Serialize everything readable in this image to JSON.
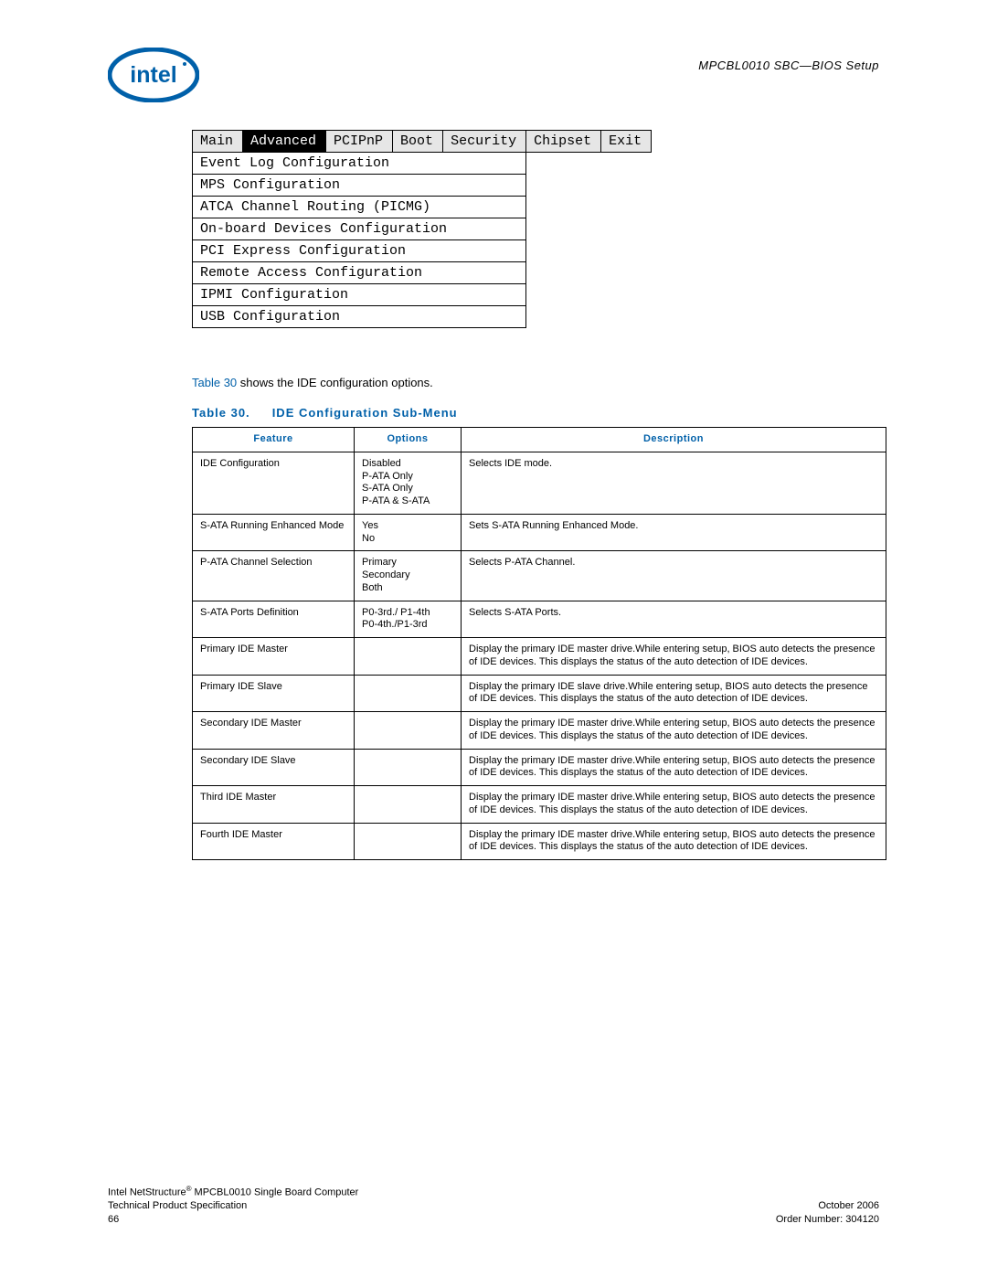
{
  "header": {
    "doc_title": "MPCBL0010 SBC—BIOS Setup"
  },
  "bios_menu": {
    "tabs": [
      "Main",
      "Advanced",
      "PCIPnP",
      "Boot",
      "Security",
      "Chipset",
      "Exit"
    ],
    "active_tab_index": 1,
    "items": [
      "Event Log Configuration",
      "MPS Configuration",
      "ATCA Channel Routing (PICMG)",
      "On-board Devices Configuration",
      "PCI Express Configuration",
      "Remote Access Configuration",
      "IPMI Configuration",
      "USB Configuration"
    ]
  },
  "intro": {
    "link": "Table 30",
    "rest": " shows the IDE configuration options."
  },
  "table_caption": {
    "number": "Table 30.",
    "title": "IDE Configuration Sub-Menu"
  },
  "table_headers": [
    "Feature",
    "Options",
    "Description"
  ],
  "config_rows": [
    {
      "feature": "IDE Configuration",
      "options": "Disabled\nP-ATA Only\nS-ATA Only\nP-ATA & S-ATA",
      "description": "Selects IDE mode."
    },
    {
      "feature": "S-ATA Running Enhanced Mode",
      "options": "Yes\nNo",
      "description": "Sets S-ATA Running Enhanced Mode."
    },
    {
      "feature": "P-ATA Channel Selection",
      "options": "Primary\nSecondary\nBoth",
      "description": "Selects P-ATA Channel."
    },
    {
      "feature": "S-ATA Ports Definition",
      "options": "P0-3rd./ P1-4th\nP0-4th./P1-3rd",
      "description": "Selects S-ATA Ports."
    },
    {
      "feature": "Primary IDE Master",
      "options": "",
      "description": "Display the primary IDE master drive.While entering setup, BIOS auto detects the presence of IDE devices. This displays the status of the auto detection of IDE devices."
    },
    {
      "feature": "Primary IDE Slave",
      "options": "",
      "description": "Display the primary IDE slave drive.While entering setup, BIOS auto detects the presence of IDE devices. This displays the status of the auto detection of IDE devices."
    },
    {
      "feature": "Secondary IDE Master",
      "options": "",
      "description": "Display the primary IDE master drive.While entering setup, BIOS auto detects the presence of IDE devices. This displays the status of the auto detection of IDE devices."
    },
    {
      "feature": "Secondary IDE Slave",
      "options": "",
      "description": "Display the primary IDE master drive.While entering setup, BIOS auto detects the presence of IDE devices. This displays the status of the auto detection of IDE devices."
    },
    {
      "feature": "Third IDE Master",
      "options": "",
      "description": "Display the primary IDE master drive.While entering setup, BIOS auto detects the presence of IDE devices. This displays the status of the auto detection of IDE devices."
    },
    {
      "feature": "Fourth IDE Master",
      "options": "",
      "description": "Display the primary IDE master drive.While entering setup, BIOS auto detects the presence of IDE devices. This displays the status of the auto detection of IDE devices."
    }
  ],
  "footer": {
    "left1": "Intel NetStructure",
    "left1b": " MPCBL0010 Single Board Computer",
    "left2": "Technical Product Specification",
    "left3": "66",
    "right1": "October 2006",
    "right2": "Order Number: 304120"
  }
}
